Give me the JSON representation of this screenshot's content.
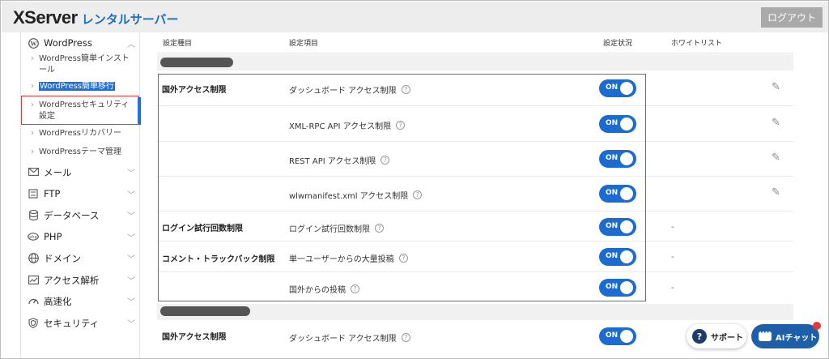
{
  "header": {
    "logo_main": "XServer",
    "logo_sub": "レンタルサーバー",
    "logout_label": "ログアウト"
  },
  "sidebar": {
    "wordpress": {
      "label": "WordPress",
      "icon": "wordpress-icon",
      "children": [
        {
          "label": "WordPress簡単インストール"
        },
        {
          "label": "WordPress簡単移行"
        },
        {
          "label": "WordPressセキュリティ設定"
        },
        {
          "label": "WordPressリカバリー"
        },
        {
          "label": "WordPressテーマ管理"
        }
      ]
    },
    "items": [
      {
        "label": "メール",
        "icon": "mail-icon"
      },
      {
        "label": "FTP",
        "icon": "ftp-icon"
      },
      {
        "label": "データベース",
        "icon": "database-icon"
      },
      {
        "label": "PHP",
        "icon": "php-icon"
      },
      {
        "label": "ドメイン",
        "icon": "globe-icon"
      },
      {
        "label": "アクセス解析",
        "icon": "chart-icon"
      },
      {
        "label": "高速化",
        "icon": "speed-icon"
      },
      {
        "label": "セキュリティ",
        "icon": "shield-icon"
      }
    ]
  },
  "table": {
    "headers": {
      "category": "設定種目",
      "item": "設定項目",
      "status": "設定状況",
      "whitelist": "ホワイトリスト"
    },
    "toggle_label": "ON",
    "categories": {
      "foreign_access": "国外アクセス制限",
      "login_limit": "ログイン試行回数制限",
      "comment_trackback": "コメント・トラックバック制限"
    },
    "rows": [
      {
        "item": "ダッシュボード アクセス制限",
        "whitelist": ""
      },
      {
        "item": "XML-RPC API アクセス制限",
        "whitelist": ""
      },
      {
        "item": "REST API アクセス制限",
        "whitelist": ""
      },
      {
        "item": "wlwmanifest.xml アクセス制限",
        "whitelist": ""
      },
      {
        "item": "ログイン試行回数制限",
        "whitelist": "-"
      },
      {
        "item": "単一ユーザーからの大量投稿",
        "whitelist": "-"
      },
      {
        "item": "国外からの投稿",
        "whitelist": "-"
      }
    ],
    "second_group": {
      "category": "国外アクセス制限",
      "item": "ダッシュボード アクセス制限"
    }
  },
  "floating": {
    "support_label": "サポート",
    "ai_label": "AIチャット"
  },
  "colors": {
    "accent": "#1c6bd0",
    "highlight_box": "#e53935",
    "brand_sub": "#1d6fc4"
  }
}
